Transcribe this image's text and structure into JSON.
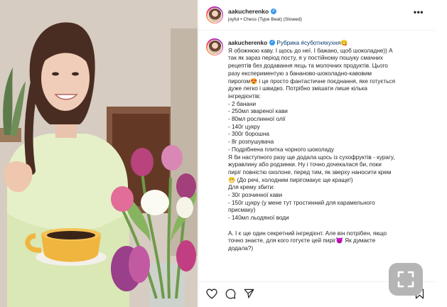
{
  "post": {
    "username": "aakucherenko",
    "audio": "joyful • Chess (Type Beat) (Slowed)"
  },
  "caption": {
    "username": "aakucherenko",
    "lines": [
      "Рубрика #суботняхухня😋",
      "Я обожнюю каву. І щось до неї. І бажано, щоб шоколадне)) А",
      "так як зараз період посту, я у постійному пошуку смачних",
      "рецептів без додавання яєць та молочних продуктів. Цього",
      "разу експериментую з бананово-шоколадно-кавовим",
      "пирогом😍 і це просто фантастичне поєднання, яке готується",
      "дуже легко і швидко. Потрібно змішати лише кілька",
      "інгредієнтів:",
      "- 2 банани",
      "- 250мл звареної кави",
      "- 80мл рослинної олії",
      "- 140г цукру",
      "- 300г борошна",
      "- 8г розпушувача",
      "- Подрібнена плитка чорного шоколаду",
      "Я би наступного разу ще додала щось із сухофруктів - курагу,",
      "журавлину або родзинки. Ну і точно дочекалася би, поки",
      "пиріг повністю охолоне, перед тим, як зверху наносити крем",
      "😬 (До речі, холодним пирігсмакує ще краще!)",
      "Для крему збити:",
      "- 30г розчинної кави",
      "- 150г цукру (у мене тут тростинний для карамельного",
      "присмаку)",
      "- 140мл льодяної води",
      "",
      "А. І є ще один секретний інгредієнт. Але він потрібен, якщо",
      "точно знаєте, для кого готуєте цей пиріг😈 Як думаєте",
      "додала?)"
    ]
  },
  "icons": {
    "like": "heart-icon",
    "comment": "comment-icon",
    "share": "send-icon",
    "save": "bookmark-icon",
    "more": "more-icon",
    "fullscreen": "fullscreen-icon"
  },
  "colors": {
    "hashtag": "#00376b",
    "verified": "#3897f0",
    "text": "#262626"
  },
  "more_label": "•••"
}
